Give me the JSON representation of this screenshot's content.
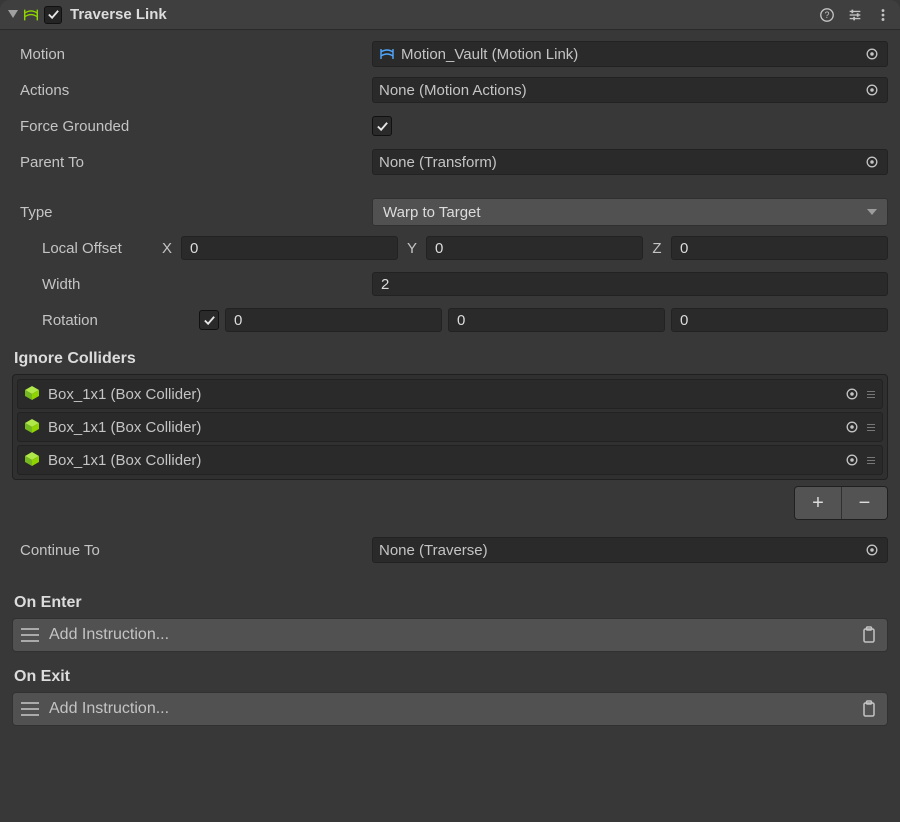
{
  "header": {
    "title": "Traverse Link",
    "enabled": true
  },
  "fields": {
    "motion": {
      "label": "Motion",
      "value": "Motion_Vault (Motion Link)"
    },
    "actions": {
      "label": "Actions",
      "value": "None (Motion Actions)"
    },
    "forceGrounded": {
      "label": "Force Grounded",
      "checked": true
    },
    "parentTo": {
      "label": "Parent To",
      "value": "None (Transform)"
    },
    "type": {
      "label": "Type",
      "value": "Warp to Target"
    },
    "localOffset": {
      "label": "Local Offset",
      "x": "0",
      "y": "0",
      "z": "0"
    },
    "width": {
      "label": "Width",
      "value": "2"
    },
    "rotation": {
      "label": "Rotation",
      "enabled": true,
      "x": "0",
      "y": "0",
      "z": "0"
    },
    "continueTo": {
      "label": "Continue To",
      "value": "None (Traverse)"
    }
  },
  "ignoreColliders": {
    "label": "Ignore Colliders",
    "items": [
      "Box_1x1 (Box Collider)",
      "Box_1x1 (Box Collider)",
      "Box_1x1 (Box Collider)"
    ],
    "addLabel": "+",
    "removeLabel": "−"
  },
  "onEnter": {
    "label": "On Enter",
    "placeholder": "Add Instruction..."
  },
  "onExit": {
    "label": "On Exit",
    "placeholder": "Add Instruction..."
  },
  "axis": {
    "x": "X",
    "y": "Y",
    "z": "Z"
  }
}
